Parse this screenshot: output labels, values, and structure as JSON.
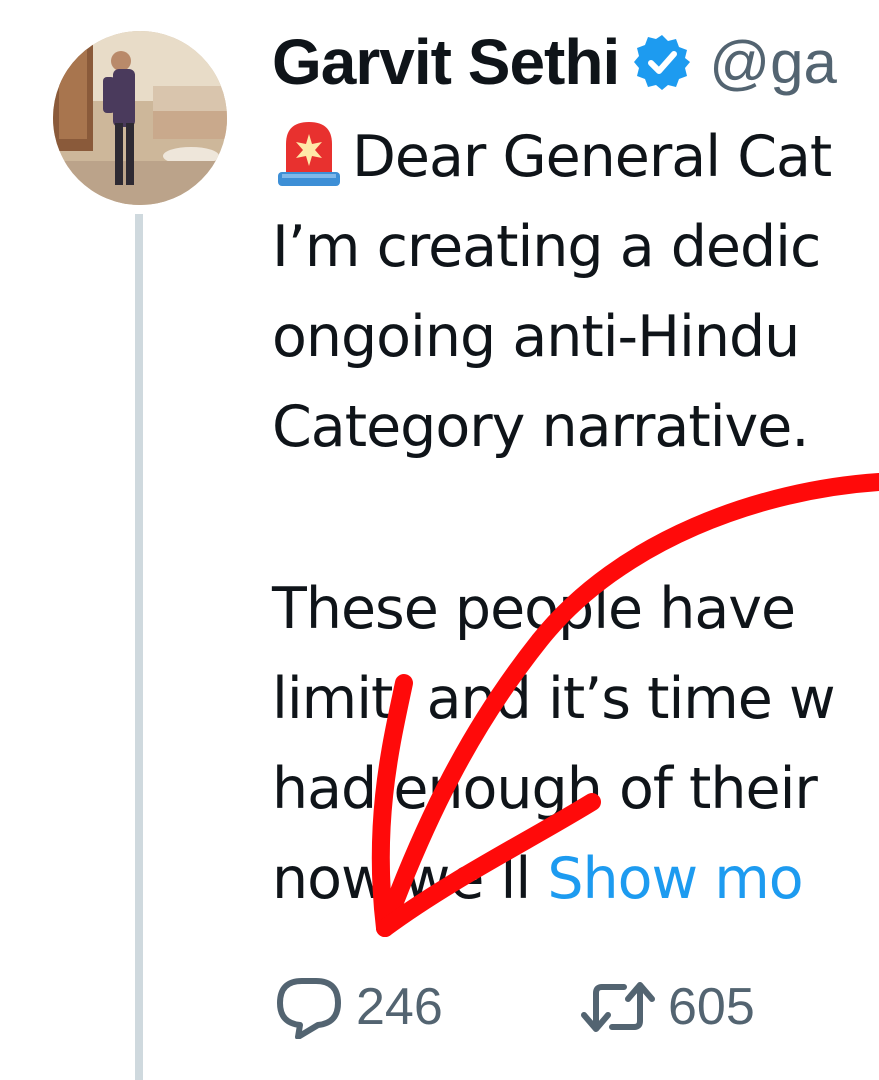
{
  "author": {
    "name": "Garvit Sethi",
    "handle": "@ga",
    "verified": true,
    "avatar_icon": "profile-photo"
  },
  "tweet": {
    "lines": [
      "Dear General Cat",
      "I’m creating a dedic",
      "ongoing anti-Hindu",
      "Category narrative.",
      "These people have",
      "limit, and it’s time w",
      "had enough of their",
      "now we’ll"
    ],
    "show_more": "Show mo",
    "lead_icon": "police-siren-icon"
  },
  "actions": {
    "replies": "246",
    "retweets": "605"
  },
  "colors": {
    "text": "#0f1419",
    "muted": "#536471",
    "link": "#1d9bf0",
    "verified": "#1d9bf0",
    "thread_line": "#cfd9de",
    "annotation": "#ff0a0a"
  }
}
